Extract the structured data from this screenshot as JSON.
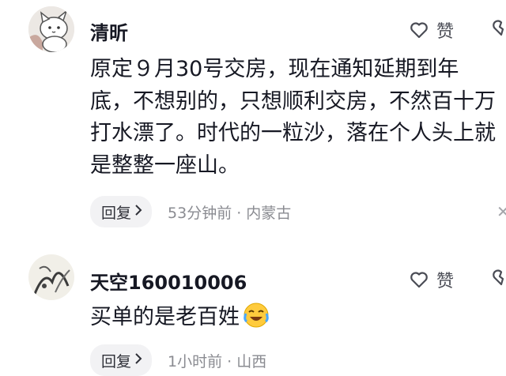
{
  "comments": [
    {
      "username": "清昕",
      "like_label": "赞",
      "content_lines": [
        "原定９月30号交房，现在通知延期到年",
        "底，不想别的，只想顺利交房，不然百十万",
        "打水漂了。时代的一粒沙，落在个人头上就",
        "是整整一座山。"
      ],
      "reply_label": "回复",
      "meta": "53分钟前 · 内蒙古"
    },
    {
      "username": "天空160010006",
      "like_label": "赞",
      "content": "买单的是老百姓",
      "emoji": "crying-laughing-emoji",
      "reply_label": "回复",
      "meta": "1小时前 · 山西"
    }
  ],
  "colors": {
    "text": "#161823",
    "secondary": "#8a8b91",
    "reply_bg": "#f2f2f4"
  }
}
